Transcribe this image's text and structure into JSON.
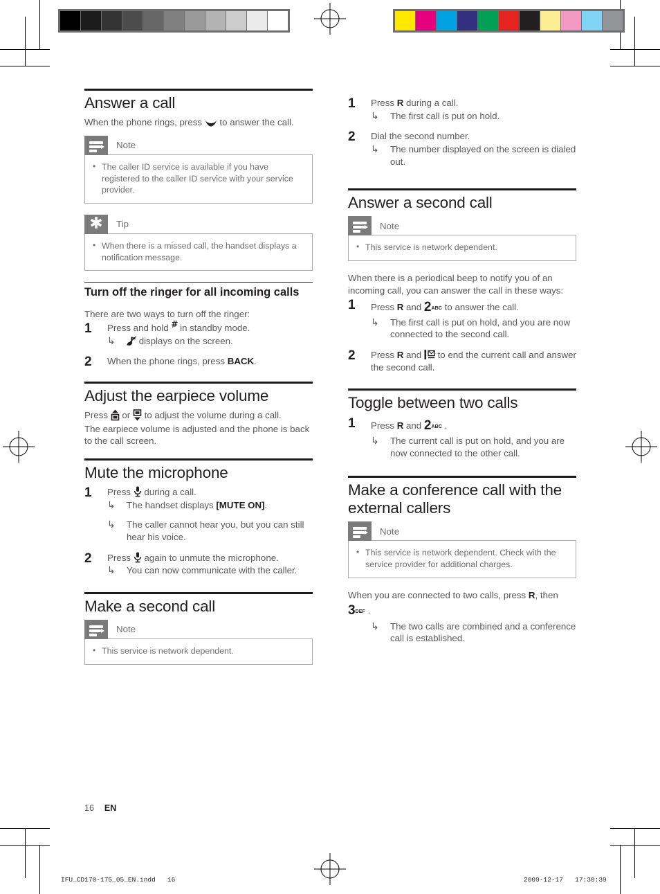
{
  "document": {
    "page_number": "16",
    "language": "EN",
    "print_meta_left": "IFU_CD170-175_05_EN.indd   16",
    "print_meta_right": "2009-12-17   17:30:39"
  },
  "calibration": {
    "grayscale_label": "grayscale-calibration-bar",
    "grayscale_swatches": [
      "#000000",
      "#1c1c1c",
      "#333333",
      "#4c4c4c",
      "#666666",
      "#808080",
      "#999999",
      "#b3b3b3",
      "#cccccc",
      "#ebebeb",
      "#ffffff"
    ],
    "color_label": "color-calibration-bar",
    "color_swatches": [
      "#ffe800",
      "#e6007e",
      "#00a0e3",
      "#33307f",
      "#00a157",
      "#e52420",
      "#231f20",
      "#fbee93",
      "#f49ac2",
      "#80d4f5",
      "#939598"
    ],
    "border_color": "#6e6e6e"
  },
  "left_column": {
    "section1": {
      "title": "Answer a call",
      "intro": "When the phone rings, press",
      "intro_icon": "phone-pickup-icon",
      "intro_tail": "to answer the call.",
      "note": {
        "label": "Note",
        "icon": "note-icon",
        "items": [
          "The caller ID service is available if you have registered to the caller ID service with your service provider."
        ]
      },
      "tip": {
        "label": "Tip",
        "icon": "tip-asterisk-icon",
        "items": [
          "When there is a missed call, the handset displays a notification message."
        ]
      }
    },
    "section2": {
      "subtitle": "Turn off the ringer for all incoming calls",
      "intro": "There are two ways to turn off the ringer:",
      "steps": [
        {
          "num": "1",
          "text_before": "Press and hold",
          "icon": "hash-key-icon",
          "text_after": "in standby mode.",
          "results": [
            {
              "icon": "ringer-off-note-icon",
              "text": "displays on the screen."
            }
          ]
        },
        {
          "num": "2",
          "text_before": "When the phone rings, press",
          "key": "BACK",
          "text_after": ".",
          "results": []
        }
      ]
    },
    "section3": {
      "title": "Adjust the earpiece volume",
      "line1_a": "Press",
      "line1_icon1": "volume-up-icon",
      "line1_b": "or",
      "line1_icon2": "volume-down-icon",
      "line1_c": "to adjust the volume during a call.",
      "line2": "The earpiece volume is adjusted and the phone is back to the call screen."
    },
    "section4": {
      "title": "Mute the microphone",
      "steps": [
        {
          "num": "1",
          "text_before": "Press",
          "icon": "microphone-icon",
          "text_after": "during a call.",
          "results": [
            {
              "text_before": "The handset displays",
              "key": "[MUTE ON]",
              "text_after": "."
            },
            {
              "text": "The caller cannot hear you, but you can still hear his voice."
            }
          ]
        },
        {
          "num": "2",
          "text_before": "Press",
          "icon": "microphone-icon",
          "text_after": "again to unmute the microphone.",
          "results": [
            {
              "text": "You can now communicate with the caller."
            }
          ]
        }
      ]
    },
    "section5": {
      "title": "Make a second call",
      "note": {
        "label": "Note",
        "icon": "note-icon",
        "items": [
          "This service is network dependent."
        ]
      }
    }
  },
  "right_column": {
    "continued_steps": [
      {
        "num": "1",
        "text_before": "Press",
        "key": "R",
        "text_after": "during a call.",
        "results": [
          {
            "text": "The first call is put on hold."
          }
        ]
      },
      {
        "num": "2",
        "text": "Dial the second number.",
        "results": [
          {
            "text": "The number displayed on the screen is dialed out."
          }
        ]
      }
    ],
    "section1": {
      "title": "Answer a second call",
      "note": {
        "label": "Note",
        "icon": "note-icon",
        "items": [
          "This service is network dependent."
        ]
      },
      "intro": "When there is a periodical beep to notify you of an incoming call, you can answer the call in these ways:",
      "steps": [
        {
          "num": "1",
          "text_before": "Press",
          "key": "R",
          "text_mid": "and",
          "keycap": "2",
          "keycap_sub": "ABC",
          "text_after": "to answer the call.",
          "results": [
            {
              "text": "The first call is put on hold, and you are now connected to the second call."
            }
          ]
        },
        {
          "num": "2",
          "text_before": "Press",
          "key": "R",
          "text_mid": "and",
          "icon": "end-call-icon",
          "text_after": "to end the current call and answer the second call.",
          "results": []
        }
      ]
    },
    "section2": {
      "title": "Toggle between two calls",
      "steps": [
        {
          "num": "1",
          "text_before": "Press",
          "key": "R",
          "text_mid": "and",
          "keycap": "2",
          "keycap_sub": "ABC",
          "text_after": ".",
          "results": [
            {
              "text": "The current call is put on hold, and you are now connected to the other call."
            }
          ]
        }
      ]
    },
    "section3": {
      "title": "Make a conference call with the external callers",
      "note": {
        "label": "Note",
        "icon": "note-icon",
        "items": [
          "This service is network dependent. Check with the service provider for additional charges."
        ]
      },
      "body_a": "When you are connected to two calls, press",
      "body_key": "R",
      "body_b": ", then",
      "body_keycap": "3",
      "body_keycap_sub": "DEF",
      "body_c": ".",
      "results": [
        {
          "text": "The two calls are combined and a conference call is established."
        }
      ]
    }
  }
}
